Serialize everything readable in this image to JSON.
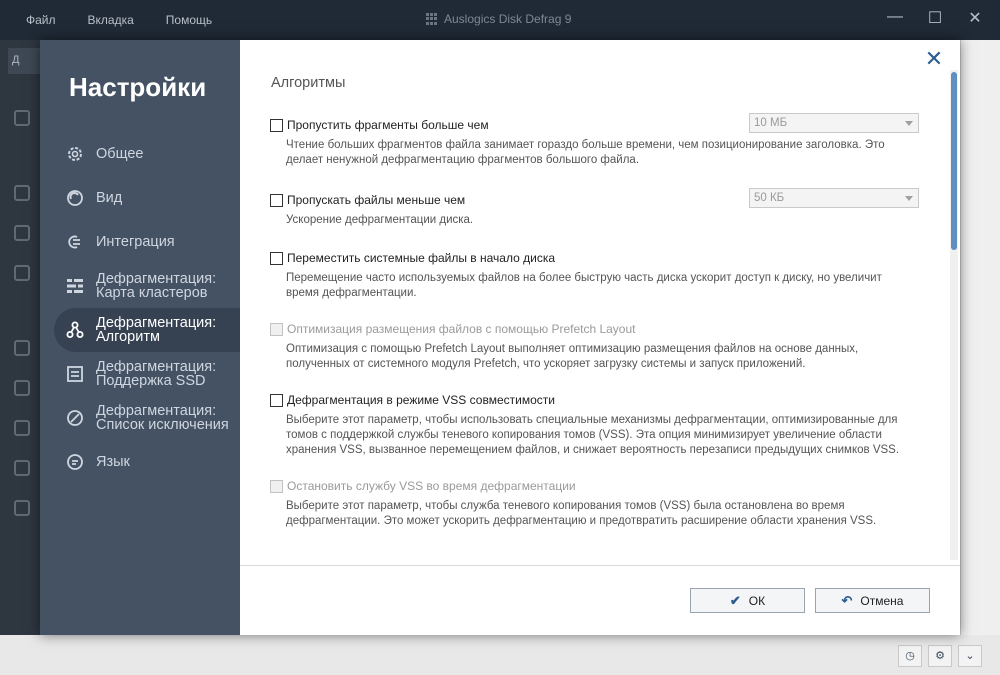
{
  "app": {
    "title": "Auslogics Disk Defrag 9",
    "menu": [
      "Файл",
      "Вкладка",
      "Помощь"
    ],
    "window_controls": [
      "—",
      "☐",
      "✕"
    ],
    "bg_tab_label": "Д"
  },
  "dialog": {
    "title": "Настройки",
    "nav": [
      {
        "label": "Общее",
        "icon": "gear-icon"
      },
      {
        "label": "Вид",
        "icon": "eye-icon"
      },
      {
        "label": "Интеграция",
        "icon": "integration-icon"
      },
      {
        "label": "Дефрагментация:\nКарта кластеров",
        "icon": "cluster-map-icon"
      },
      {
        "label": "Дефрагментация:\nАлгоритм",
        "icon": "algorithm-icon",
        "active": true
      },
      {
        "label": "Дефрагментация:\nПоддержка SSD",
        "icon": "ssd-icon"
      },
      {
        "label": "Дефрагментация:\nСписок исключения",
        "icon": "exclude-icon"
      },
      {
        "label": "Язык",
        "icon": "language-icon"
      }
    ],
    "section_title": "Алгоритмы",
    "options": [
      {
        "label": "Пропустить фрагменты больше чем",
        "checked": false,
        "enabled": true,
        "desc": "Чтение больших фрагментов файла занимает гораздо больше времени, чем позиционирование заголовка. Это делает ненужной дефрагментацию фрагментов большого файла.",
        "select_value": "10 МБ"
      },
      {
        "label": "Пропускать файлы меньше чем",
        "checked": false,
        "enabled": true,
        "desc": "Ускорение дефрагментации диска.",
        "select_value": "50 КБ"
      },
      {
        "label": "Переместить системные файлы в начало диска",
        "checked": false,
        "enabled": true,
        "desc": "Перемещение часто используемых файлов на более быструю часть диска ускорит доступ к диску, но увеличит время дефрагментации."
      },
      {
        "label": "Оптимизация размещения файлов с помощью Prefetch Layout",
        "checked": false,
        "enabled": false,
        "desc": "Оптимизация с помощью Prefetch Layout выполняет оптимизацию размещения файлов на основе данных, полученных от системного модуля Prefetch, что ускоряет загрузку системы и запуск приложений."
      },
      {
        "label": "Дефрагментация в режиме VSS совместимости",
        "checked": false,
        "enabled": true,
        "desc": "Выберите этот параметр, чтобы использовать специальные механизмы дефрагментации, оптимизированные для томов с поддержкой службы теневого копирования томов (VSS). Эта опция минимизирует увеличение области хранения VSS, вызванное перемещением файлов, и снижает вероятность перезаписи предыдущих снимков VSS."
      },
      {
        "label": "Остановить службу VSS во время дефрагментации",
        "checked": false,
        "enabled": false,
        "desc": "Выберите этот параметр, чтобы служба теневого копирования томов (VSS) была остановлена во время дефрагментации. Это может ускорить дефрагментацию и предотвратить расширение области хранения VSS."
      }
    ],
    "ok_label": "ОК",
    "cancel_label": "Отмена"
  },
  "colors": {
    "sidebar": "#445264",
    "sidebar_active": "#364252",
    "accent": "#2c5d8f",
    "scroll_thumb": "#5f8fc1"
  }
}
